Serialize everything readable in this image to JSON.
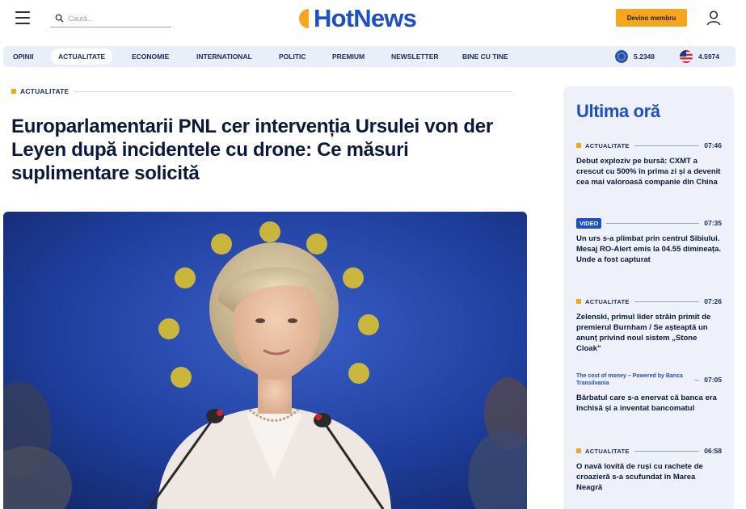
{
  "header": {
    "search_placeholder": "Caută...",
    "logo_text": "HotNews",
    "member_button": "Devino membru"
  },
  "nav": {
    "items": [
      "OPINII",
      "ACTUALITATE",
      "ECONOMIE",
      "INTERNATIONAL",
      "POLITIC",
      "PREMIUM",
      "NEWSLETTER",
      "BINE CU TINE"
    ],
    "active": "ACTUALITATE",
    "rates": [
      {
        "icon": "eu-flag-icon",
        "value": "5.2348"
      },
      {
        "icon": "us-flag-icon",
        "value": "4.5974"
      }
    ]
  },
  "article": {
    "category": "ACTUALITATE",
    "headline": "Europarlamentarii PNL cer intervenția Ursulei von der Leyen după incidentele cu drone: Ce măsuri suplimentare solicită"
  },
  "sidebar": {
    "title": "Ultima oră",
    "items": [
      {
        "tag": "ACTUALITATE",
        "time": "07:46",
        "text": "Debut exploziv pe bursă: CXMT a crescut cu 500% în prima zi și a devenit cea mai valoroasă companie din China"
      },
      {
        "tag": "VIDEO",
        "time": "07:35",
        "text": "Un urs s-a plimbat prin centrul Sibiului. Mesaj RO-Alert emis la 04.55 dimineața. Unde a fost capturat"
      },
      {
        "tag": "ACTUALITATE",
        "time": "07:26",
        "text": "Zelenski, primul lider străin primit de premierul Burnham / Se așteaptă un anunț privind noul sistem „Stone Cloak”"
      },
      {
        "tag": "The cost of money – Powered by Banca Transilvania",
        "time": "07:05",
        "text": "Bărbatul care s-a enervat că banca era închisă și a inventat bancomatul"
      },
      {
        "tag": "ACTUALITATE",
        "time": "06:58",
        "text": "O navă lovită de ruși cu rachete de croazieră s-a scufundat în Marea Neagră"
      }
    ]
  },
  "colors": {
    "brand_blue": "#1d4fc7",
    "accent_orange": "#f7a51c",
    "nav_bg": "#e9eef8",
    "sidebar_bg": "#eef1f9"
  }
}
